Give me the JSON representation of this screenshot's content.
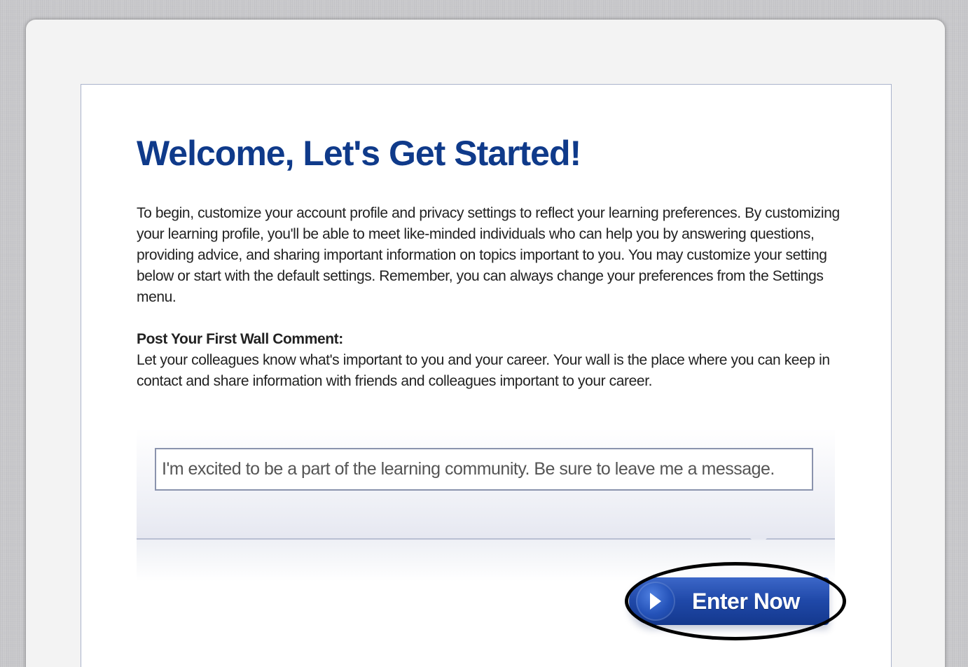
{
  "welcome": {
    "title": "Welcome, Let's Get Started!",
    "intro": "To begin, customize your account profile and privacy settings to reflect your learning preferences. By customizing your learning profile, you'll be able to meet like-minded individuals who can help you by answering questions, providing advice, and sharing important information on topics important to you. You may customize your setting below or start with the default settings. Remember, you can always change your preferences from the Settings menu."
  },
  "wall_comment": {
    "heading": "Post Your First Wall Comment:",
    "description": "Let your colleagues know what's important to you and your career. Your wall is the place where you can keep in contact and share information with friends and colleagues important to your career.",
    "input_value": "I'm excited to be a part of the learning community. Be sure to leave me a message."
  },
  "actions": {
    "enter_label": "Enter Now",
    "enter_icon": "play-arrow-icon"
  },
  "colors": {
    "title": "#0f3a8a",
    "button": "#1f48a8",
    "annotation_ring": "#000000"
  }
}
